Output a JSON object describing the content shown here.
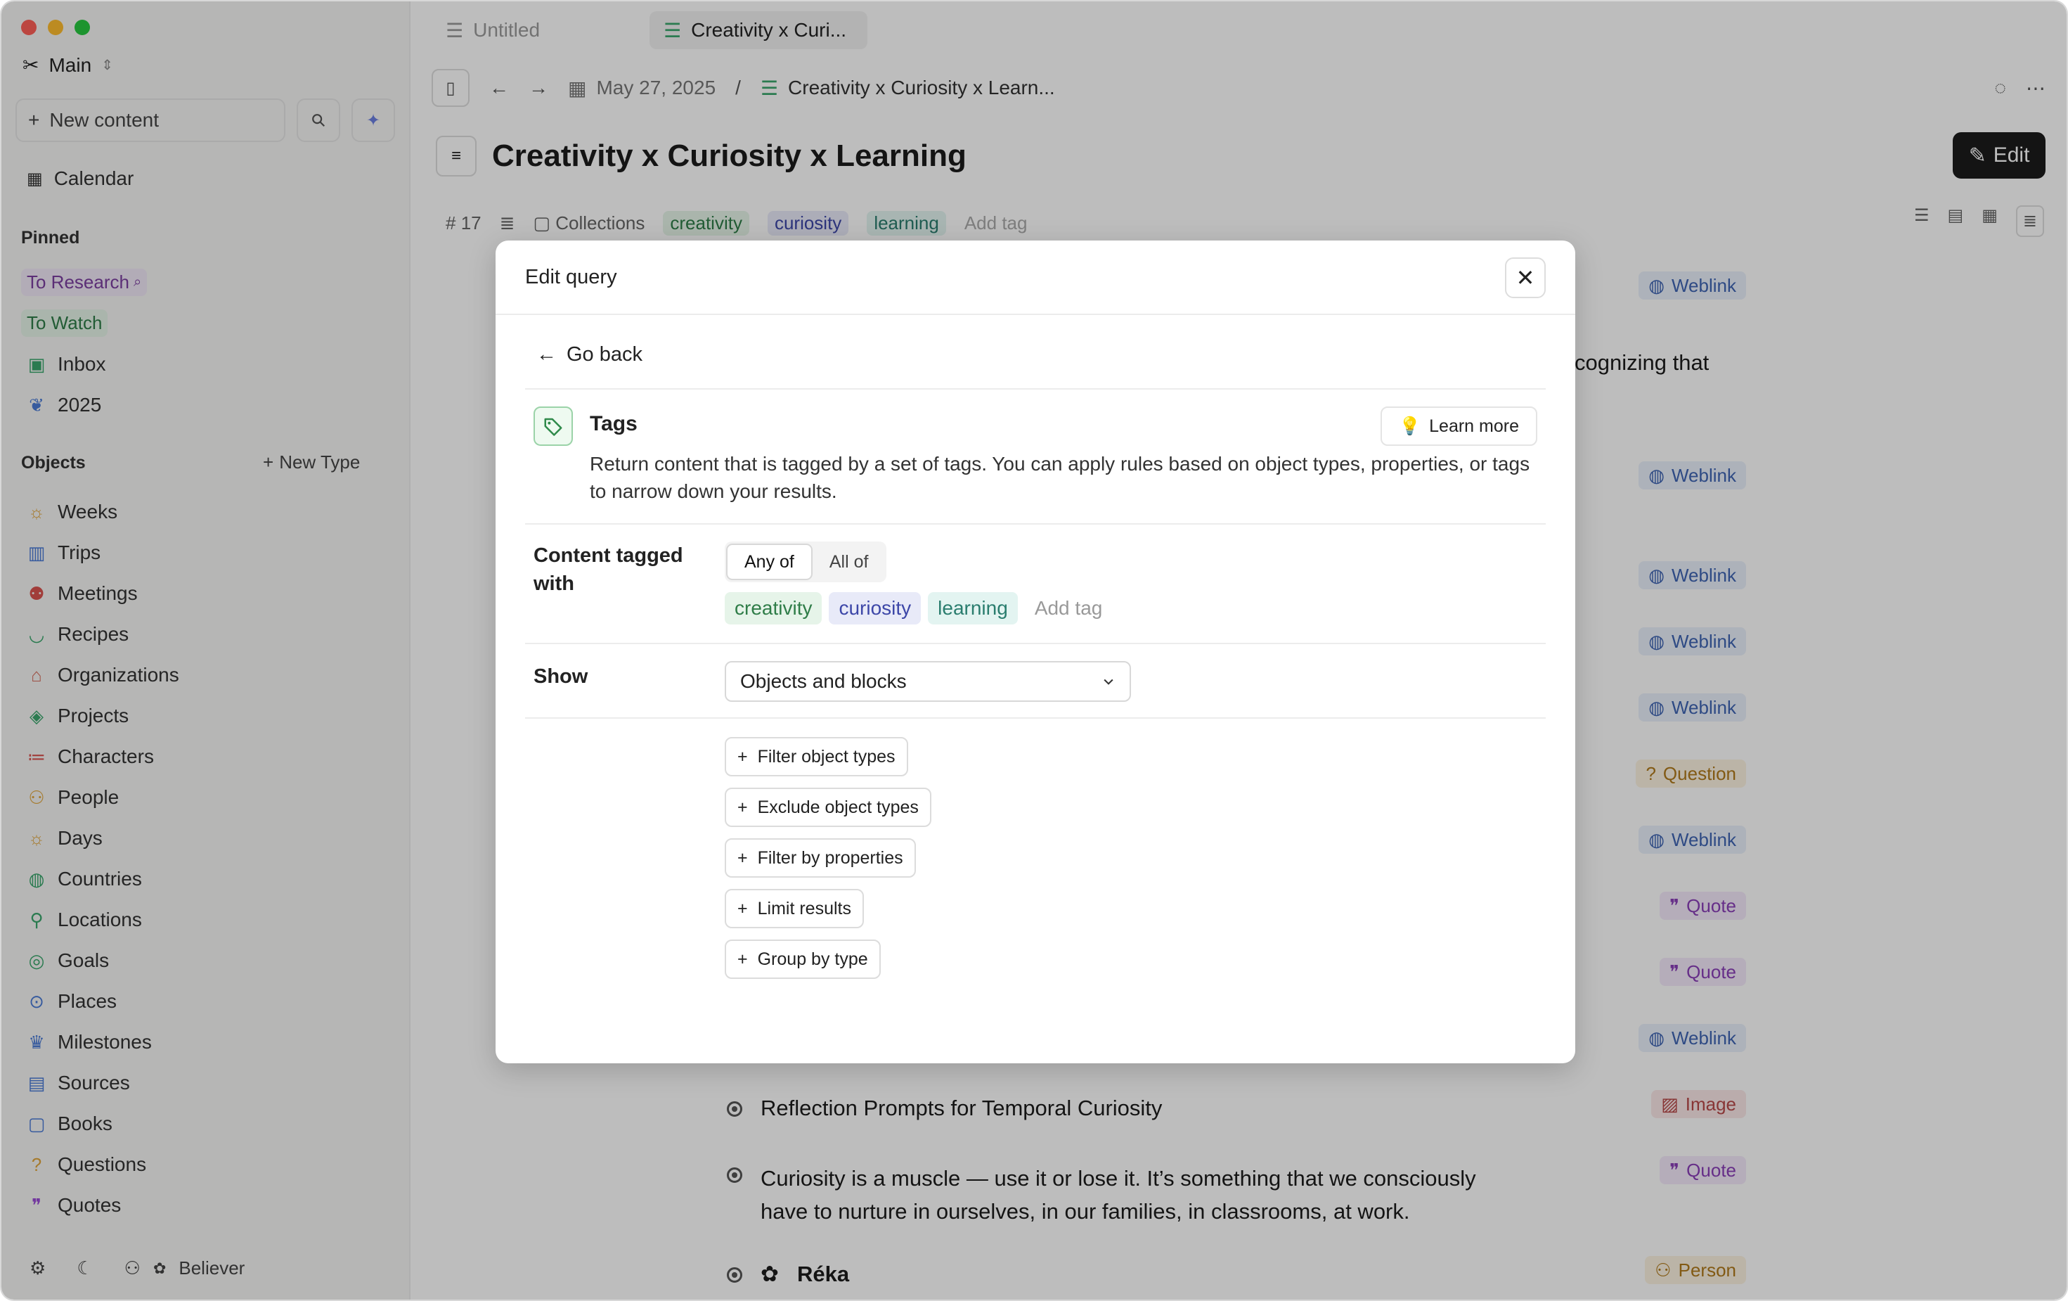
{
  "sidebar": {
    "workspace": "Main",
    "new_content": "New content",
    "calendar": "Calendar",
    "pinned_header": "Pinned",
    "pinned": [
      {
        "label": "To Research"
      },
      {
        "label": "To Watch"
      },
      {
        "label": "Inbox"
      },
      {
        "label": "2025"
      }
    ],
    "objects_header": "Objects",
    "new_type": "New Type",
    "objects": [
      {
        "label": "Weeks",
        "icon": "sun-icon",
        "color": "#e0a53a"
      },
      {
        "label": "Trips",
        "icon": "bag-icon",
        "color": "#4b7bd6"
      },
      {
        "label": "Meetings",
        "icon": "people-icon",
        "color": "#d9534f"
      },
      {
        "label": "Recipes",
        "icon": "bowl-icon",
        "color": "#3aa76d"
      },
      {
        "label": "Organizations",
        "icon": "building-icon",
        "color": "#d46b5b"
      },
      {
        "label": "Projects",
        "icon": "cube-icon",
        "color": "#3aa76d"
      },
      {
        "label": "Characters",
        "icon": "id-icon",
        "color": "#d9534f"
      },
      {
        "label": "People",
        "icon": "person-icon",
        "color": "#e0a53a"
      },
      {
        "label": "Days",
        "icon": "sun-icon",
        "color": "#e0a53a"
      },
      {
        "label": "Countries",
        "icon": "globe-icon",
        "color": "#3aa76d"
      },
      {
        "label": "Locations",
        "icon": "pin-icon",
        "color": "#3aa76d"
      },
      {
        "label": "Goals",
        "icon": "target-icon",
        "color": "#3aa76d"
      },
      {
        "label": "Places",
        "icon": "location-icon",
        "color": "#4b7bd6"
      },
      {
        "label": "Milestones",
        "icon": "trophy-icon",
        "color": "#4b7bd6"
      },
      {
        "label": "Sources",
        "icon": "books-icon",
        "color": "#4b7bd6"
      },
      {
        "label": "Books",
        "icon": "book-icon",
        "color": "#4b7bd6"
      },
      {
        "label": "Questions",
        "icon": "question-icon",
        "color": "#e0a53a"
      },
      {
        "label": "Quotes",
        "icon": "quote-icon",
        "color": "#9a4bd6"
      }
    ],
    "footer_user": "Believer"
  },
  "tabs": [
    {
      "label": "Untitled"
    },
    {
      "label": "Creativity x Curi..."
    }
  ],
  "toolbar": {
    "date": "May 27, 2025",
    "separator": "/",
    "crumb": "Creativity x Curiosity x Learn..."
  },
  "page": {
    "title": "Creativity x Curiosity x Learning",
    "edit_label": "Edit",
    "count": "17",
    "collections": "Collections",
    "tags": [
      "creativity",
      "curiosity",
      "learning"
    ],
    "add_tag": "Add tag",
    "partial_text": "cognizing that"
  },
  "background_badges": [
    {
      "label": "Weblink"
    },
    {
      "label": "Weblink"
    },
    {
      "label": "Weblink"
    },
    {
      "label": "Weblink"
    },
    {
      "label": "Weblink"
    },
    {
      "label": "Question"
    },
    {
      "label": "Weblink"
    },
    {
      "label": "Quote"
    },
    {
      "label": "Quote"
    },
    {
      "label": "Weblink"
    },
    {
      "label": "Image"
    },
    {
      "label": "Quote"
    },
    {
      "label": "Person"
    }
  ],
  "content_lines": [
    {
      "text": "Reflection Prompts for Temporal Curiosity"
    },
    {
      "text": "Curiosity is a muscle — use it or lose it. It’s something that we consciously"
    },
    {
      "text": "have to nurture in ourselves, in our families, in classrooms, at work."
    },
    {
      "text": "Réka"
    }
  ],
  "modal": {
    "title": "Edit query",
    "go_back": "Go back",
    "section_title": "Tags",
    "learn_more": "Learn more",
    "description": "Return content that is tagged by a set of tags. You can apply rules based on object types, properties, or tags to narrow down your results.",
    "content_tagged_label_1": "Content tagged",
    "content_tagged_label_2": "with",
    "mode_options": [
      "Any of",
      "All of"
    ],
    "tags": [
      "creativity",
      "curiosity",
      "learning"
    ],
    "add_tag": "Add tag",
    "show_label": "Show",
    "show_value": "Objects and blocks",
    "actions": [
      "Filter object types",
      "Exclude object types",
      "Filter by properties",
      "Limit results",
      "Group by type"
    ]
  }
}
